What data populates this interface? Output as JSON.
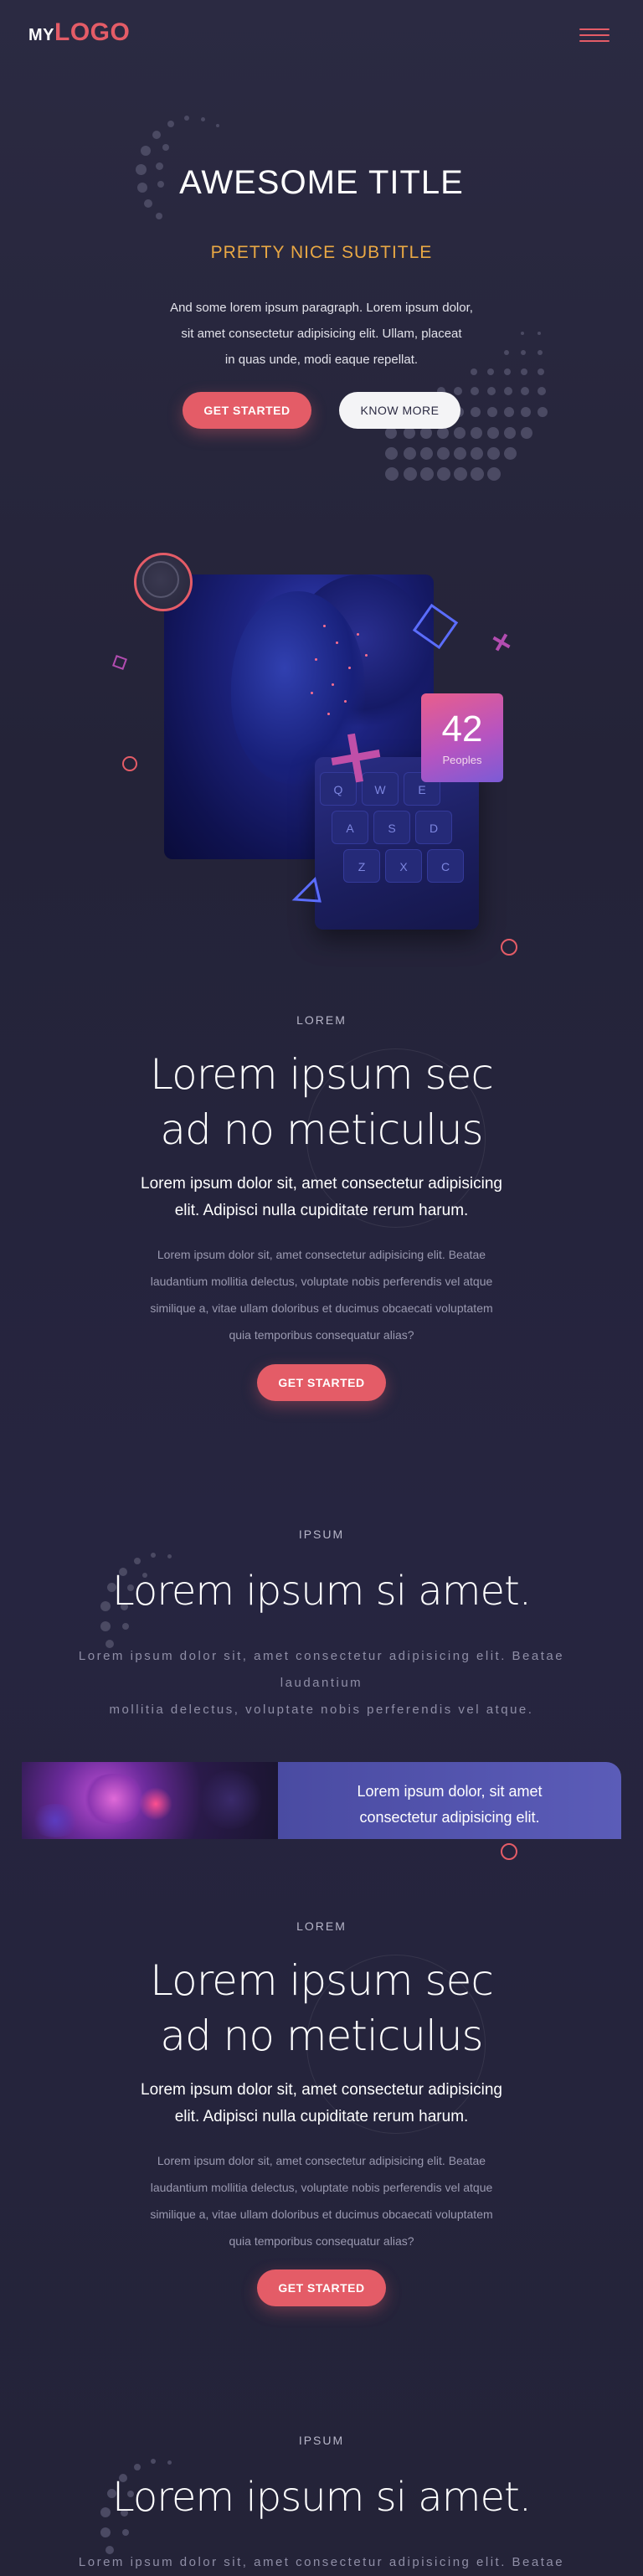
{
  "header": {
    "logo_prefix": "MY",
    "logo_main": "LOGO",
    "menu_icon": "hamburger-menu-icon"
  },
  "hero": {
    "title": "AWESOME TITLE",
    "subtitle": "PRETTY NICE SUBTITLE",
    "paragraph_lines": [
      "And some lorem ipsum paragraph. Lorem ipsum dolor,",
      "sit amet consectetur adipisicing elit. Ullam, placeat",
      "in quas unde, modi eaque repellat."
    ],
    "primary_button": "GET STARTED",
    "secondary_button": "KNOW MORE"
  },
  "stat_card": {
    "number": "42",
    "label": "Peoples"
  },
  "section_one": {
    "eyebrow": "LOREM",
    "title_lines": [
      "Lorem ipsum sec",
      "ad no meticulus"
    ],
    "lead_lines": [
      "Lorem ipsum dolor sit, amet consectetur adipisicing",
      "elit. Adipisci nulla cupiditate rerum harum."
    ],
    "paragraph_lines": [
      "Lorem ipsum dolor sit, amet consectetur adipisicing elit. Beatae",
      "laudantium mollitia delectus, voluptate nobis perferendis vel atque",
      "similique a, vitae ullam doloribus et ducimus obcaecati voluptatem",
      "quia temporibus consequatur alias?"
    ],
    "button": "GET STARTED"
  },
  "section_two": {
    "eyebrow": "IPSUM",
    "title": "Lorem ipsum si amet.",
    "paragraph_lines": [
      "Lorem ipsum dolor sit, amet consectetur adipisicing elit. Beatae",
      "laudantium",
      "mollitia delectus, voluptate nobis perferendis vel atque."
    ]
  },
  "banner": {
    "text_lines": [
      "Lorem ipsum dolor, sit amet",
      "consectetur adipisicing elit."
    ]
  },
  "section_three": {
    "eyebrow": "LOREM",
    "title_lines": [
      "Lorem ipsum sec",
      "ad no meticulus"
    ],
    "lead_lines": [
      "Lorem ipsum dolor sit, amet consectetur adipisicing",
      "elit. Adipisci nulla cupiditate rerum harum."
    ],
    "paragraph_lines": [
      "Lorem ipsum dolor sit, amet consectetur adipisicing elit. Beatae",
      "laudantium mollitia delectus, voluptate nobis perferendis vel atque",
      "similique a, vitae ullam doloribus et ducimus obcaecati voluptatem",
      "quia temporibus consequatur alias?"
    ],
    "button": "GET STARTED"
  },
  "section_four": {
    "eyebrow": "IPSUM",
    "title": "Lorem ipsum si amet.",
    "paragraph_first_line": "Lorem ipsum dolor sit, amet consectetur adipisicing elit. Beatae"
  },
  "colors": {
    "accent": "#e45c67",
    "subtitle": "#e9a844",
    "background": "#24233a",
    "banner": "#5b5cb8"
  },
  "keyboard_keys": [
    "Q",
    "W",
    "E",
    "A",
    "S",
    "D",
    "Z",
    "X",
    "C"
  ]
}
